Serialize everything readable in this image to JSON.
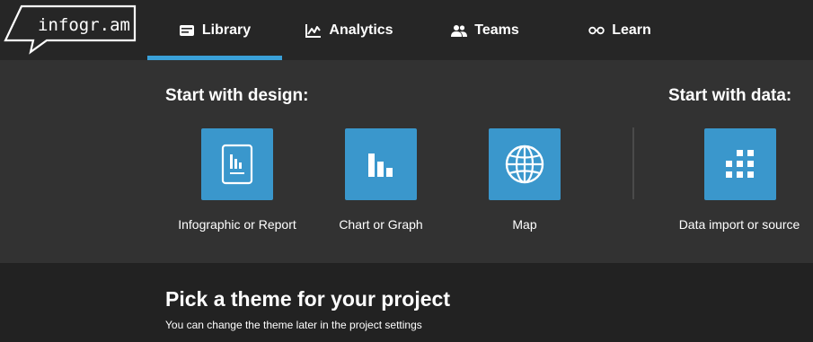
{
  "app": {
    "logo_text": "infogr.am"
  },
  "nav": {
    "items": [
      {
        "label": "Library",
        "icon": "library-icon",
        "active": true
      },
      {
        "label": "Analytics",
        "icon": "analytics-icon",
        "active": false
      },
      {
        "label": "Teams",
        "icon": "teams-icon",
        "active": false
      },
      {
        "label": "Learn",
        "icon": "learn-icon",
        "active": false
      }
    ]
  },
  "design": {
    "title": "Start with design:",
    "options": [
      {
        "label": "Infographic or Report",
        "icon": "infographic-report-icon"
      },
      {
        "label": "Chart or Graph",
        "icon": "bar-chart-icon"
      },
      {
        "label": "Map",
        "icon": "globe-icon"
      }
    ]
  },
  "data_section": {
    "title": "Start with data:",
    "options": [
      {
        "label": "Data import or source",
        "icon": "data-grid-icon"
      }
    ]
  },
  "theme": {
    "title": "Pick a theme for your project",
    "subtitle": "You can change the theme later in the project settings"
  },
  "colors": {
    "accent": "#3aa0d8",
    "tile": "#3a97cc",
    "topbar": "#262626",
    "panel": "#323232",
    "background": "#222222"
  }
}
